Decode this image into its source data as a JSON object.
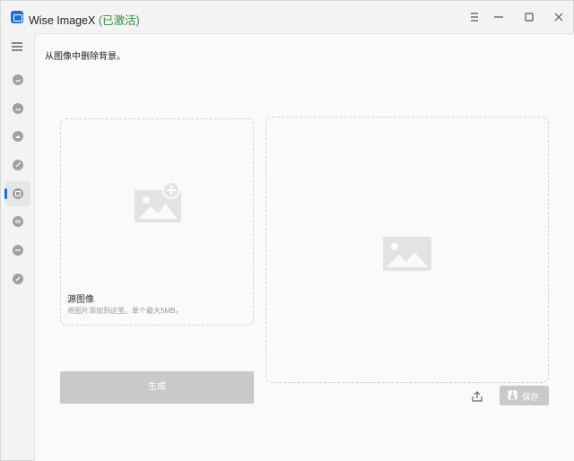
{
  "titlebar": {
    "app_name": "Wise ImageX",
    "status": "(已激活)",
    "status_color": "#2d8f3e"
  },
  "sidebar": {
    "items": [
      {
        "icon": "image-icon",
        "active": false
      },
      {
        "icon": "image-enhance-icon",
        "active": false
      },
      {
        "icon": "image-upscale-icon",
        "active": false
      },
      {
        "icon": "image-colorize-icon",
        "active": false
      },
      {
        "icon": "remove-background-icon",
        "active": true
      },
      {
        "icon": "image-convert-icon",
        "active": false
      },
      {
        "icon": "image-compress-icon",
        "active": false
      },
      {
        "icon": "image-watermark-icon",
        "active": false
      }
    ],
    "accent_color": "#1f6fd1"
  },
  "main": {
    "instruction": "从图像中删除背景。",
    "source": {
      "title": "源图像",
      "hint": "将图片添加到这里。单个最大5MB。"
    },
    "generate_label": "生成",
    "save_label": "保存"
  }
}
